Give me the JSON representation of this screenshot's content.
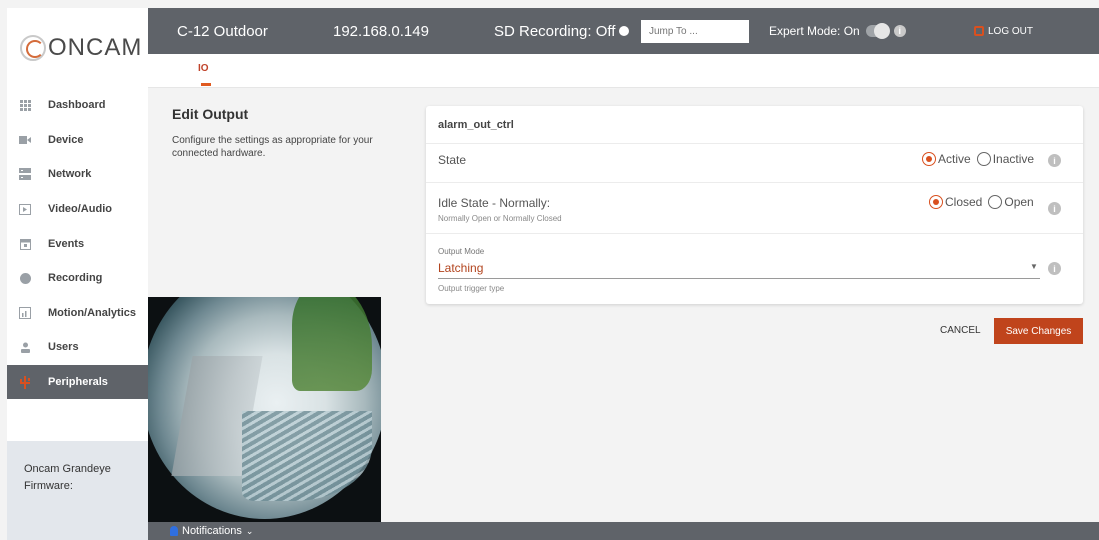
{
  "app": {
    "logo_text": "ONCAM"
  },
  "sidebar": {
    "items": [
      {
        "label": "Dashboard",
        "icon": "grid-icon",
        "active": false
      },
      {
        "label": "Device",
        "icon": "camera-icon",
        "active": false
      },
      {
        "label": "Network",
        "icon": "network-icon",
        "active": false
      },
      {
        "label": "Video/Audio",
        "icon": "play-icon",
        "active": false
      },
      {
        "label": "Events",
        "icon": "calendar-icon",
        "active": false
      },
      {
        "label": "Recording",
        "icon": "record-icon",
        "active": false
      },
      {
        "label": "Motion/Analytics",
        "icon": "chart-icon",
        "active": false
      },
      {
        "label": "Users",
        "icon": "user-icon",
        "active": false
      },
      {
        "label": "Peripherals",
        "icon": "usb-icon",
        "active": true
      }
    ],
    "firmware_line1": "Oncam Grandeye",
    "firmware_line2": "Firmware:"
  },
  "topbar": {
    "device_name": "C-12 Outdoor",
    "ip": "192.168.0.149",
    "sd_recording": "SD Recording: Off",
    "jump_placeholder": "Jump To ...",
    "expert_mode": "Expert Mode: On",
    "logout": "LOG OUT"
  },
  "tabs": {
    "active": "IO"
  },
  "edit": {
    "title": "Edit Output",
    "description": "Configure the settings as appropriate for your connected hardware."
  },
  "card": {
    "name": "alarm_out_ctrl",
    "state_label": "State",
    "state_options": [
      "Active",
      "Inactive"
    ],
    "state_selected": "Active",
    "idle_label": "Idle State - Normally:",
    "idle_sub": "Normally Open or Normally Closed",
    "idle_options": [
      "Closed",
      "Open"
    ],
    "idle_selected": "Closed",
    "output_mode_label": "Output Mode",
    "output_mode_value": "Latching",
    "output_mode_hint": "Output trigger type"
  },
  "actions": {
    "cancel": "CANCEL",
    "save": "Save Changes"
  },
  "footer": {
    "notifications": "Notifications"
  },
  "colors": {
    "accent": "#c0441c",
    "topbar": "#5f6369"
  }
}
